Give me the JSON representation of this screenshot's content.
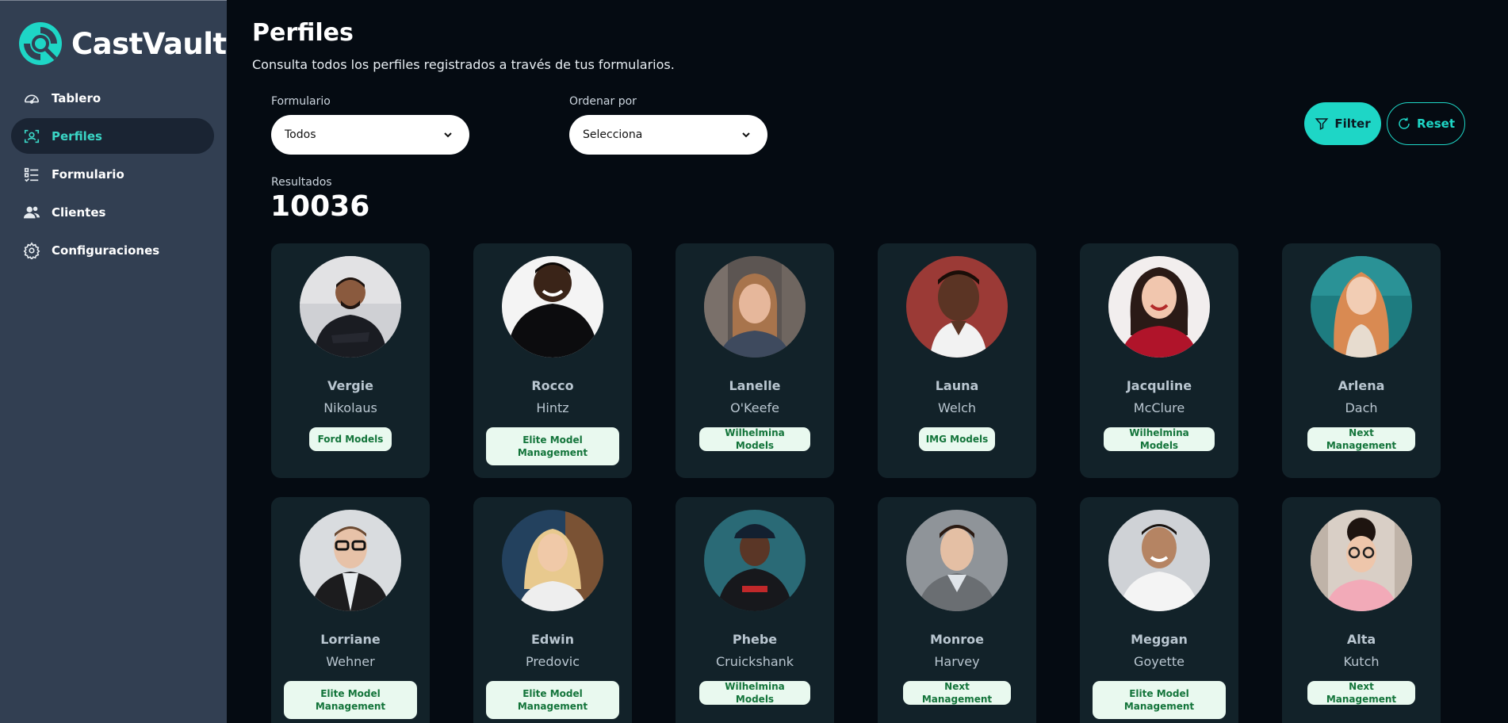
{
  "app": {
    "name": "CastVault"
  },
  "sidebar": {
    "items": [
      {
        "label": "Tablero",
        "icon": "dashboard-gauge-icon",
        "active": false
      },
      {
        "label": "Perfiles",
        "icon": "profile-scan-icon",
        "active": true
      },
      {
        "label": "Formulario",
        "icon": "form-list-icon",
        "active": false
      },
      {
        "label": "Clientes",
        "icon": "users-icon",
        "active": false
      },
      {
        "label": "Configuraciones",
        "icon": "gear-icon",
        "active": false
      }
    ]
  },
  "header": {
    "title": "Perfiles",
    "subtitle": "Consulta todos los perfiles registrados a través de tus formularios."
  },
  "filters": {
    "form_label": "Formulario",
    "form_value": "Todos",
    "sort_label": "Ordenar por",
    "sort_value": "Selecciona",
    "filter_button": "Filter",
    "reset_button": "Reset"
  },
  "results": {
    "label": "Resultados",
    "count": "10036"
  },
  "colors": {
    "accent": "#1ed6c6",
    "sidebar_bg": "#323f52",
    "page_bg": "#050b12",
    "card_bg": "#122229",
    "badge_bg": "#e9f9ef",
    "badge_text": "#13743a"
  },
  "profiles": [
    {
      "first_name": "Vergie",
      "last_name": "Nikolaus",
      "agency": "Ford Models"
    },
    {
      "first_name": "Rocco",
      "last_name": "Hintz",
      "agency": "Elite Model Management"
    },
    {
      "first_name": "Lanelle",
      "last_name": "O'Keefe",
      "agency": "Wilhelmina Models"
    },
    {
      "first_name": "Launa",
      "last_name": "Welch",
      "agency": "IMG Models"
    },
    {
      "first_name": "Jacquline",
      "last_name": "McClure",
      "agency": "Wilhelmina Models"
    },
    {
      "first_name": "Arlena",
      "last_name": "Dach",
      "agency": "Next Management"
    },
    {
      "first_name": "Lorriane",
      "last_name": "Wehner",
      "agency": "Elite Model Management"
    },
    {
      "first_name": "Edwin",
      "last_name": "Predovic",
      "agency": "Elite Model Management"
    },
    {
      "first_name": "Phebe",
      "last_name": "Cruickshank",
      "agency": "Wilhelmina Models"
    },
    {
      "first_name": "Monroe",
      "last_name": "Harvey",
      "agency": "Next Management"
    },
    {
      "first_name": "Meggan",
      "last_name": "Goyette",
      "agency": "Elite Model Management"
    },
    {
      "first_name": "Alta",
      "last_name": "Kutch",
      "agency": "Next Management"
    }
  ]
}
